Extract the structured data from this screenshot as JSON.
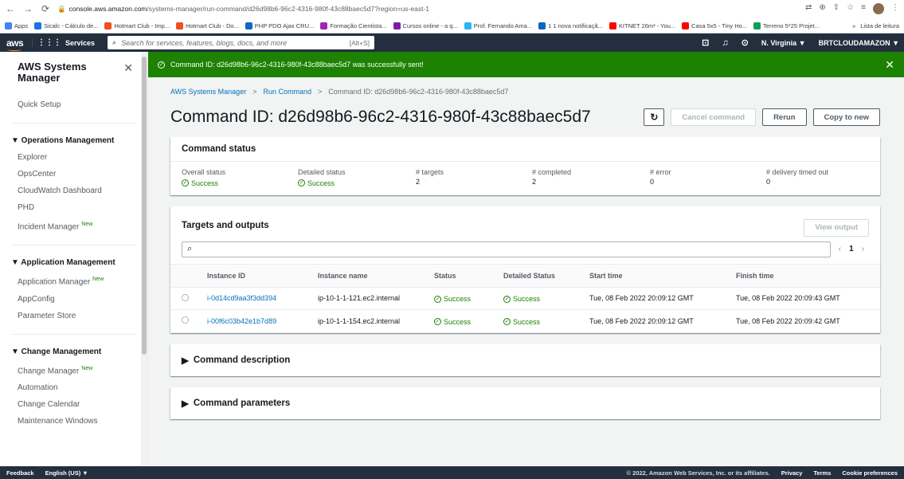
{
  "browser": {
    "url_host": "console.aws.amazon.com",
    "url_path": "/systems-manager/run-command/d26d98b6-96c2-4316-980f-43c88baec5d7?region=us-east-1",
    "bookmarks": [
      {
        "label": "Apps",
        "color": "#4285f4"
      },
      {
        "label": "Sicalc - Cálculo de...",
        "color": "#1a73e8"
      },
      {
        "label": "Hotmart Club - Imp...",
        "color": "#f04e23"
      },
      {
        "label": "Hotmart Club - Do...",
        "color": "#f04e23"
      },
      {
        "label": "PHP PDO Ajax CRU...",
        "color": "#1565c0"
      },
      {
        "label": "Formação Cientista...",
        "color": "#9c27b0"
      },
      {
        "label": "Cursos online - a q...",
        "color": "#7b1fa2"
      },
      {
        "label": "Prof. Fernando Ama...",
        "color": "#29b6f6"
      },
      {
        "label": "1 1 nova notificaçã...",
        "color": "#0a66c2"
      },
      {
        "label": "KITNET 26m² - You...",
        "color": "#ff0000"
      },
      {
        "label": "Casa 5x5 - Tiny Ho...",
        "color": "#ff0000"
      },
      {
        "label": "Terreno 5*25 Projet...",
        "color": "#0f9d58"
      }
    ],
    "bookmarks_more": "»",
    "reading_list": "Lista de leitura"
  },
  "topbar": {
    "logo": "aws",
    "services": "Services",
    "search_placeholder": "Search for services, features, blogs, docs, and more",
    "search_shortcut": "[Alt+S]",
    "region": "N. Virginia ▼",
    "account": "BRTCLOUDAMAZON ▼"
  },
  "sidebar": {
    "title": "AWS Systems Manager",
    "quick_setup": "Quick Setup",
    "sections": [
      {
        "title": "▼ Operations Management",
        "items": [
          {
            "label": "Explorer",
            "new": ""
          },
          {
            "label": "OpsCenter",
            "new": ""
          },
          {
            "label": "CloudWatch Dashboard",
            "new": ""
          },
          {
            "label": "PHD",
            "new": ""
          },
          {
            "label": "Incident Manager",
            "new": "New"
          }
        ]
      },
      {
        "title": "▼ Application Management",
        "items": [
          {
            "label": "Application Manager",
            "new": "New"
          },
          {
            "label": "AppConfig",
            "new": ""
          },
          {
            "label": "Parameter Store",
            "new": ""
          }
        ]
      },
      {
        "title": "▼ Change Management",
        "items": [
          {
            "label": "Change Manager",
            "new": "New"
          },
          {
            "label": "Automation",
            "new": ""
          },
          {
            "label": "Change Calendar",
            "new": ""
          },
          {
            "label": "Maintenance Windows",
            "new": ""
          }
        ]
      }
    ]
  },
  "flash": {
    "message": "Command ID: d26d98b6-96c2-4316-980f-43c88baec5d7 was successfully sent!"
  },
  "breadcrumb": {
    "root": "AWS Systems Manager",
    "parent": "Run Command",
    "current": "Command ID: d26d98b6-96c2-4316-980f-43c88baec5d7"
  },
  "page": {
    "title": "Command ID: d26d98b6-96c2-4316-980f-43c88baec5d7",
    "cancel": "Cancel command",
    "rerun": "Rerun",
    "copy_to_new": "Copy to new"
  },
  "status": {
    "heading": "Command status",
    "fields": [
      {
        "label": "Overall status",
        "value": "Success",
        "ok": true
      },
      {
        "label": "Detailed status",
        "value": "Success",
        "ok": true
      },
      {
        "label": "# targets",
        "value": "2",
        "ok": false
      },
      {
        "label": "# completed",
        "value": "2",
        "ok": false
      },
      {
        "label": "# error",
        "value": "0",
        "ok": false
      },
      {
        "label": "# delivery timed out",
        "value": "0",
        "ok": false
      }
    ]
  },
  "targets": {
    "heading": "Targets and outputs",
    "view_output": "View output",
    "page": "1",
    "columns": [
      "Instance ID",
      "Instance name",
      "Status",
      "Detailed Status",
      "Start time",
      "Finish time"
    ],
    "rows": [
      {
        "id": "i-0d14cd9aa3f3dd394",
        "name": "ip-10-1-1-121.ec2.internal",
        "status": "Success",
        "detailed": "Success",
        "start": "Tue, 08 Feb 2022 20:09:12 GMT",
        "finish": "Tue, 08 Feb 2022 20:09:43 GMT"
      },
      {
        "id": "i-00f6c03b42e1b7d89",
        "name": "ip-10-1-1-154.ec2.internal",
        "status": "Success",
        "detailed": "Success",
        "start": "Tue, 08 Feb 2022 20:09:12 GMT",
        "finish": "Tue, 08 Feb 2022 20:09:42 GMT"
      }
    ]
  },
  "sections": {
    "description": "Command description",
    "parameters": "Command parameters"
  },
  "footer": {
    "feedback": "Feedback",
    "language": "English (US) ▼",
    "copyright": "© 2022, Amazon Web Services, Inc. or its affiliates.",
    "privacy": "Privacy",
    "terms": "Terms",
    "cookies": "Cookie preferences"
  }
}
